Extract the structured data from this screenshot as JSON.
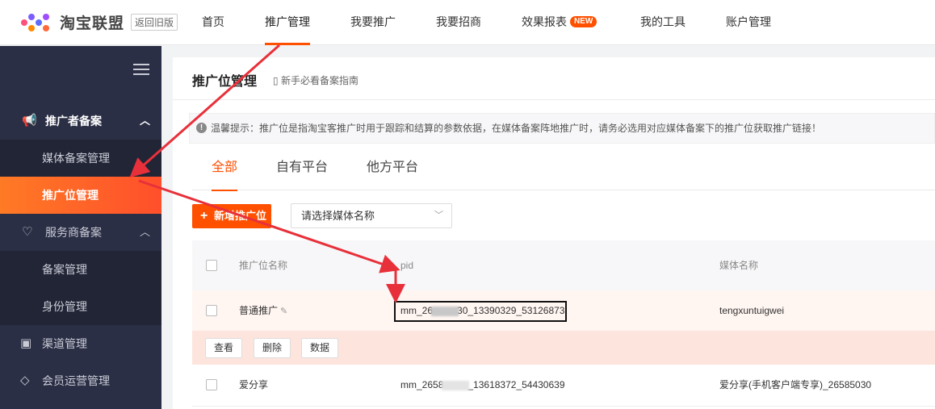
{
  "topnav": {
    "logo_text": "淘宝联盟",
    "old_version": "返回旧版",
    "items": [
      {
        "label": "首页"
      },
      {
        "label": "推广管理"
      },
      {
        "label": "我要推广"
      },
      {
        "label": "我要招商"
      },
      {
        "label": "效果报表",
        "badge": "NEW"
      },
      {
        "label": "我的工具"
      },
      {
        "label": "账户管理"
      }
    ],
    "active_index": 1
  },
  "sidebar": {
    "groups": [
      {
        "label": "推广者备案",
        "icon": "megaphone-icon",
        "expanded": true,
        "items": [
          {
            "label": "媒体备案管理"
          },
          {
            "label": "推广位管理",
            "active": true
          }
        ]
      },
      {
        "label": "服务商备案",
        "icon": "handshake-icon",
        "expanded": true,
        "items": [
          {
            "label": "备案管理"
          },
          {
            "label": "身份管理"
          }
        ]
      },
      {
        "label": "渠道管理",
        "icon": "chart-icon"
      },
      {
        "label": "会员运营管理",
        "icon": "diamond-icon"
      }
    ]
  },
  "page": {
    "title": "推广位管理",
    "guide_link": "新手必看备案指南",
    "tip": "温馨提示：推广位是指淘宝客推广时用于跟踪和结算的参数依据，在媒体备案阵地推广时，请务必选用对应媒体备案下的推广位获取推广链接！",
    "tabs": [
      {
        "label": "全部"
      },
      {
        "label": "自有平台"
      },
      {
        "label": "他方平台"
      }
    ],
    "active_tab": 0,
    "add_button": "新增推广位",
    "media_select_placeholder": "请选择媒体名称"
  },
  "table": {
    "columns": [
      "推广位名称",
      "pid",
      "媒体名称"
    ],
    "rows": [
      {
        "name": "普通推广",
        "pid_prefix": "mm_26",
        "pid_suffix": "30_13390329_53126873",
        "media": "tengxuntuigwei"
      },
      {
        "name": "爱分享",
        "pid_prefix": "mm_2658",
        "pid_suffix": "_13618372_54430639",
        "media": "爱分享(手机客户端专享)_26585030"
      }
    ],
    "row_actions": [
      "查看",
      "删除",
      "数据"
    ]
  },
  "colors": {
    "accent": "#ff5000",
    "sidebar_bg": "#2b2f45",
    "annotation": "#e8303a"
  }
}
